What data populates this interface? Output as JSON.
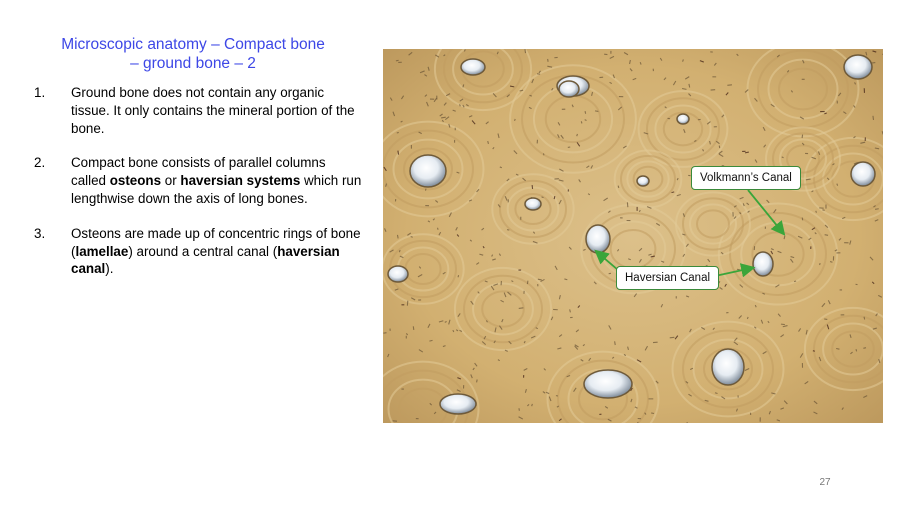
{
  "slide": {
    "title_line1": "Microscopic anatomy – Compact bone",
    "title_line2": "– ground bone – 2",
    "items": [
      {
        "num": "1.",
        "parts": [
          {
            "text": "Ground bone does not contain any organic tissue.  It only contains the mineral portion of the bone.",
            "bold": false
          }
        ]
      },
      {
        "num": "2.",
        "parts": [
          {
            "text": "Compact bone consists of parallel columns called ",
            "bold": false
          },
          {
            "text": "osteons",
            "bold": true
          },
          {
            "text": " or ",
            "bold": false
          },
          {
            "text": "haversian systems",
            "bold": true
          },
          {
            "text": " which run lengthwise down the axis of long bones.",
            "bold": false
          }
        ]
      },
      {
        "num": "3.",
        "parts": [
          {
            "text": "Osteons are made up of concentric rings of bone (",
            "bold": false
          },
          {
            "text": "lamellae",
            "bold": true
          },
          {
            "text": ") around a central canal (",
            "bold": false
          },
          {
            "text": "haversian canal",
            "bold": true
          },
          {
            "text": ").",
            "bold": false
          }
        ]
      }
    ],
    "image": {
      "callout_volkmann": "Volkmann’s Canal",
      "callout_haversian": "Haversian Canal",
      "callout_color": "#3a8a3a"
    },
    "page_number": "27"
  },
  "colors": {
    "title": "#3d47e6",
    "bone_background": "#d6b577"
  }
}
